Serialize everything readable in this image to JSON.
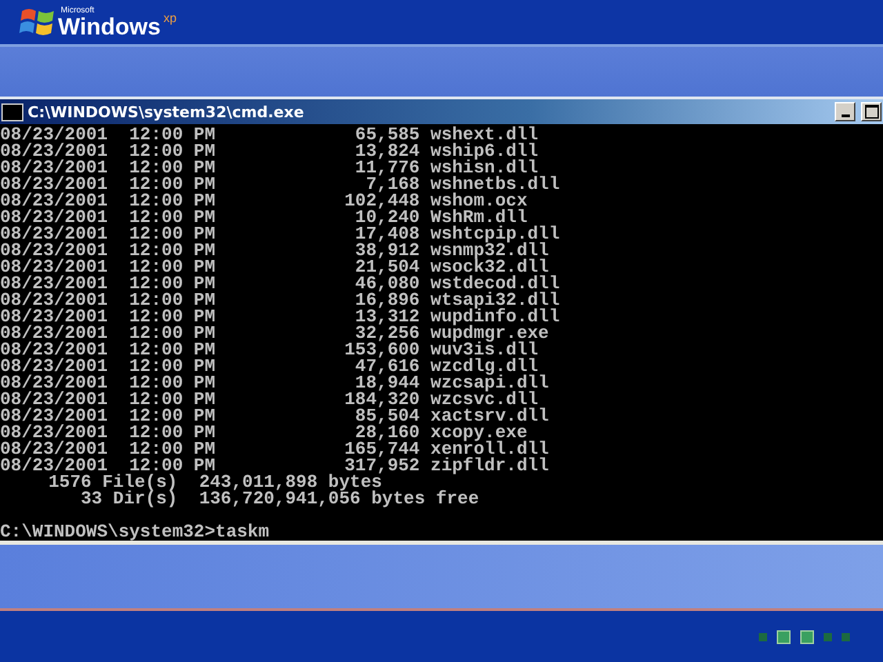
{
  "banner": {
    "logo_small": "Microsoft",
    "logo_word": "Windows",
    "logo_sup": "xp"
  },
  "console_window": {
    "title": "C:\\WINDOWS\\system32\\cmd.exe",
    "rows": [
      {
        "date": "08/23/2001",
        "time": "12:00 PM",
        "size": "65,585",
        "name": "wshext.dll"
      },
      {
        "date": "08/23/2001",
        "time": "12:00 PM",
        "size": "13,824",
        "name": "wship6.dll"
      },
      {
        "date": "08/23/2001",
        "time": "12:00 PM",
        "size": "11,776",
        "name": "wshisn.dll"
      },
      {
        "date": "08/23/2001",
        "time": "12:00 PM",
        "size": "7,168",
        "name": "wshnetbs.dll"
      },
      {
        "date": "08/23/2001",
        "time": "12:00 PM",
        "size": "102,448",
        "name": "wshom.ocx"
      },
      {
        "date": "08/23/2001",
        "time": "12:00 PM",
        "size": "10,240",
        "name": "WshRm.dll"
      },
      {
        "date": "08/23/2001",
        "time": "12:00 PM",
        "size": "17,408",
        "name": "wshtcpip.dll"
      },
      {
        "date": "08/23/2001",
        "time": "12:00 PM",
        "size": "38,912",
        "name": "wsnmp32.dll"
      },
      {
        "date": "08/23/2001",
        "time": "12:00 PM",
        "size": "21,504",
        "name": "wsock32.dll"
      },
      {
        "date": "08/23/2001",
        "time": "12:00 PM",
        "size": "46,080",
        "name": "wstdecod.dll"
      },
      {
        "date": "08/23/2001",
        "time": "12:00 PM",
        "size": "16,896",
        "name": "wtsapi32.dll"
      },
      {
        "date": "08/23/2001",
        "time": "12:00 PM",
        "size": "13,312",
        "name": "wupdinfo.dll"
      },
      {
        "date": "08/23/2001",
        "time": "12:00 PM",
        "size": "32,256",
        "name": "wupdmgr.exe"
      },
      {
        "date": "08/23/2001",
        "time": "12:00 PM",
        "size": "153,600",
        "name": "wuv3is.dll"
      },
      {
        "date": "08/23/2001",
        "time": "12:00 PM",
        "size": "47,616",
        "name": "wzcdlg.dll"
      },
      {
        "date": "08/23/2001",
        "time": "12:00 PM",
        "size": "18,944",
        "name": "wzcsapi.dll"
      },
      {
        "date": "08/23/2001",
        "time": "12:00 PM",
        "size": "184,320",
        "name": "wzcsvc.dll"
      },
      {
        "date": "08/23/2001",
        "time": "12:00 PM",
        "size": "85,504",
        "name": "xactsrv.dll"
      },
      {
        "date": "08/23/2001",
        "time": "12:00 PM",
        "size": "28,160",
        "name": "xcopy.exe"
      },
      {
        "date": "08/23/2001",
        "time": "12:00 PM",
        "size": "165,744",
        "name": "xenroll.dll"
      },
      {
        "date": "08/23/2001",
        "time": "12:00 PM",
        "size": "317,952",
        "name": "zipfldr.dll"
      }
    ],
    "summary": [
      {
        "count": "1576 File(s)",
        "bytes": "243,011,898 bytes"
      },
      {
        "count": "33 Dir(s)",
        "bytes": "136,720,941,056 bytes free"
      }
    ],
    "prompt": "C:\\WINDOWS\\system32>taskm"
  },
  "progress_dots": [
    {
      "on": false
    },
    {
      "on": true
    },
    {
      "on": true
    },
    {
      "on": false
    },
    {
      "on": false
    }
  ]
}
